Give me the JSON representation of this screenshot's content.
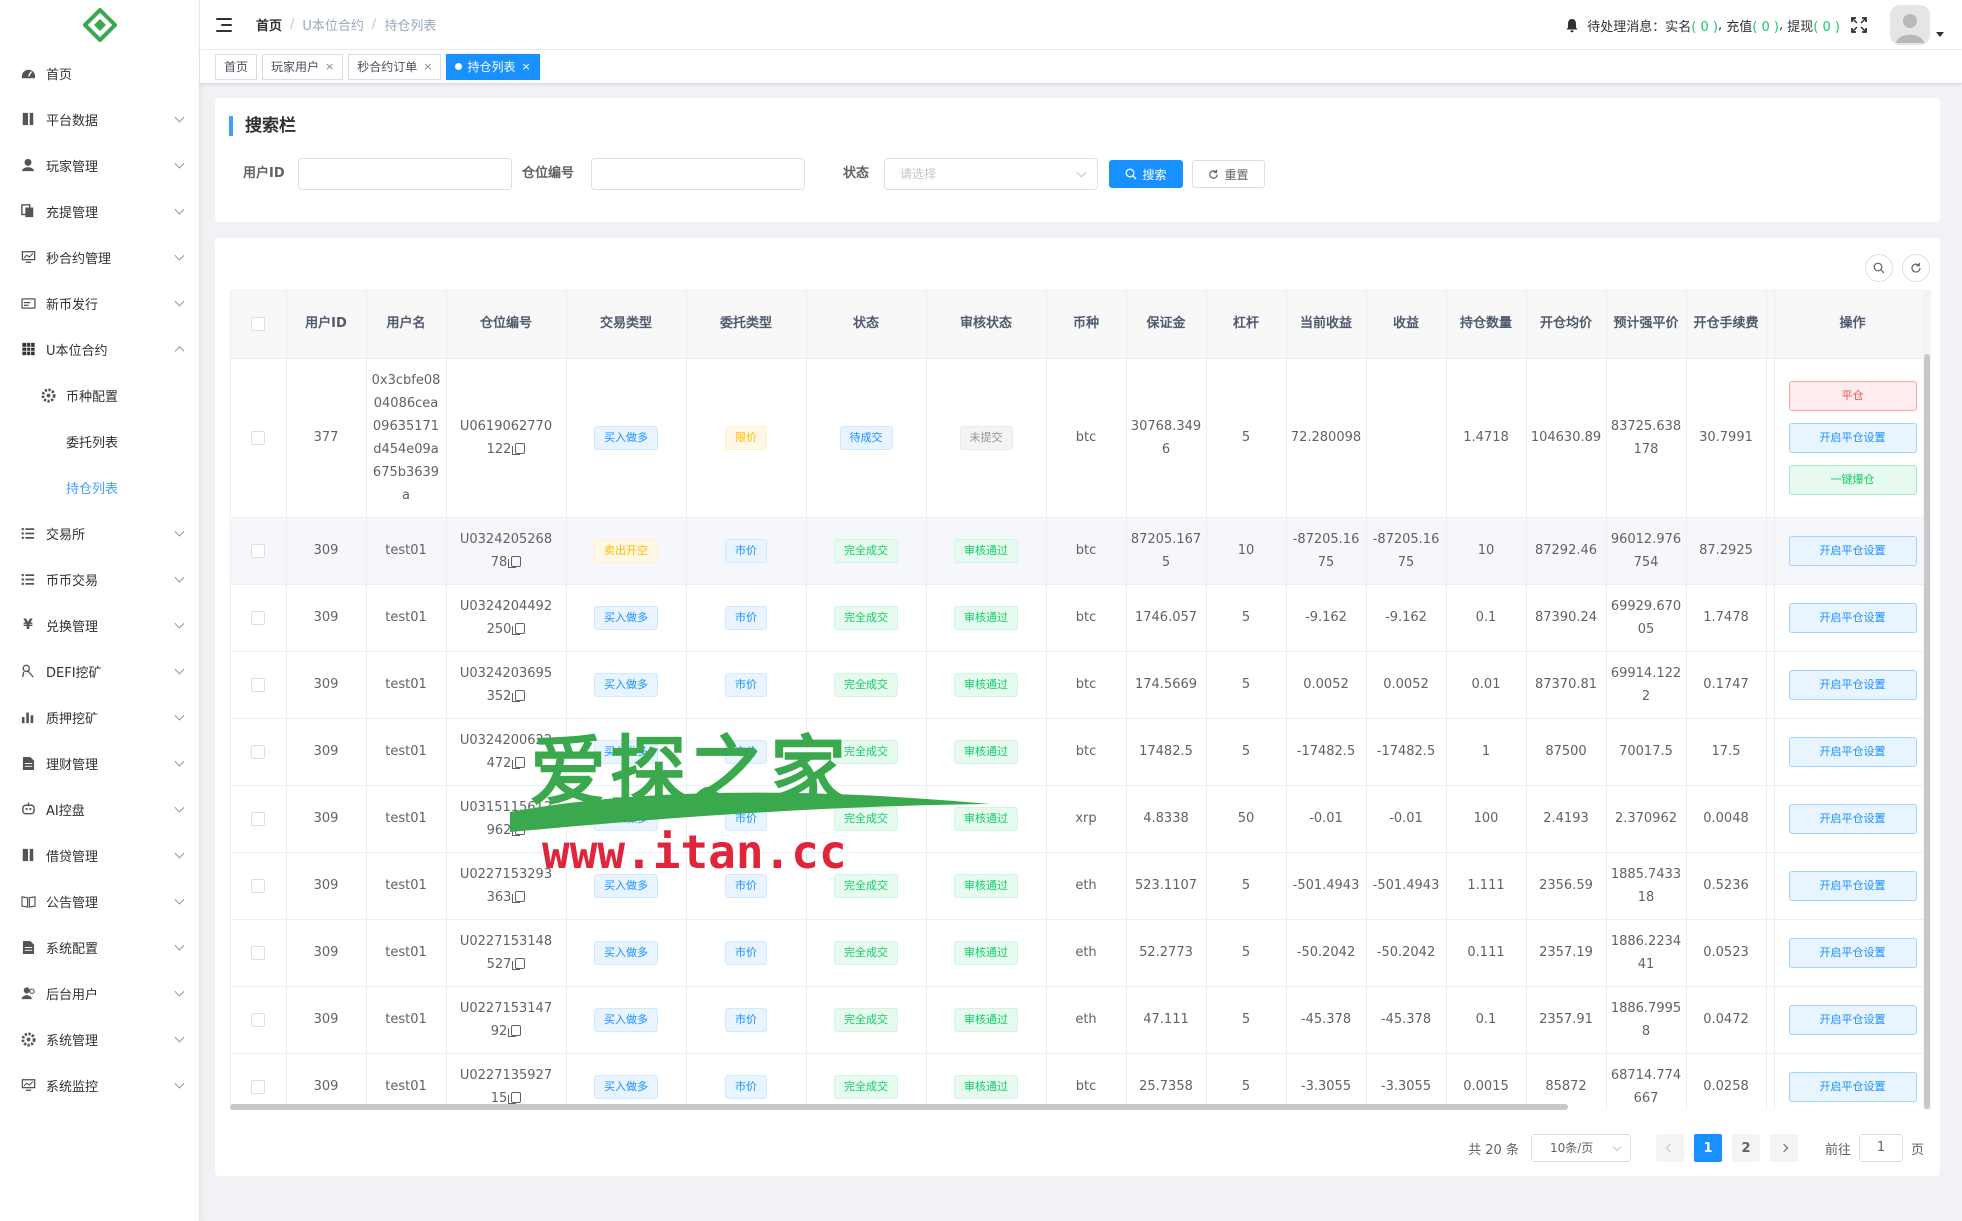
{
  "sidebar": {
    "items": [
      {
        "label": "首页",
        "icon": "dashboard-icon",
        "arrow": false
      },
      {
        "label": "平台数据",
        "icon": "book-icon",
        "arrow": true
      },
      {
        "label": "玩家管理",
        "icon": "user-icon",
        "arrow": true
      },
      {
        "label": "充提管理",
        "icon": "copy-icon",
        "arrow": true
      },
      {
        "label": "秒合约管理",
        "icon": "monitor-icon",
        "arrow": true
      },
      {
        "label": "新币发行",
        "icon": "card-icon",
        "arrow": true
      },
      {
        "label": "U本位合约",
        "icon": "table-icon",
        "arrow": true,
        "expanded": true
      },
      {
        "label": "币种配置",
        "icon": "gear-icon",
        "level": 1
      },
      {
        "label": "委托列表",
        "level": 2
      },
      {
        "label": "持仓列表",
        "level": 2,
        "active": true
      },
      {
        "label": "交易所",
        "icon": "list-icon",
        "arrow": true
      },
      {
        "label": "币币交易",
        "icon": "list-icon",
        "arrow": true
      },
      {
        "label": "兑换管理",
        "icon": "yen-icon",
        "arrow": true
      },
      {
        "label": "DEFI挖矿",
        "icon": "tool-icon",
        "arrow": true
      },
      {
        "label": "质押挖矿",
        "icon": "chart-icon",
        "arrow": true
      },
      {
        "label": "理财管理",
        "icon": "document-icon",
        "arrow": true
      },
      {
        "label": "AI控盘",
        "icon": "robot-icon",
        "arrow": true
      },
      {
        "label": "借贷管理",
        "icon": "book-icon",
        "arrow": true
      },
      {
        "label": "公告管理",
        "icon": "open-book-icon",
        "arrow": true
      },
      {
        "label": "系统配置",
        "icon": "document-icon",
        "arrow": true
      },
      {
        "label": "后台用户",
        "icon": "users-icon",
        "arrow": true
      },
      {
        "label": "系统管理",
        "icon": "gear-icon",
        "arrow": true
      },
      {
        "label": "系统监控",
        "icon": "monitor-icon",
        "arrow": true
      }
    ]
  },
  "navbar": {
    "breadcrumb": [
      "首页",
      "U本位合约",
      "持仓列表"
    ],
    "pending_label": "待处理消息：",
    "realname_label": "实名",
    "recharge_label": "充值",
    "withdraw_label": "提现",
    "realname_count": "0",
    "recharge_count": "0",
    "withdraw_count": "0"
  },
  "tags": [
    {
      "label": "首页",
      "closable": false,
      "active": false
    },
    {
      "label": "玩家用户",
      "closable": true,
      "active": false
    },
    {
      "label": "秒合约订单",
      "closable": true,
      "active": false
    },
    {
      "label": "持仓列表",
      "closable": true,
      "active": true
    }
  ],
  "search": {
    "title": "搜索栏",
    "user_id_label": "用户ID",
    "user_id_value": "",
    "position_no_label": "仓位编号",
    "position_no_value": "",
    "status_label": "状态",
    "status_placeholder": "请选择",
    "search_button": "搜索",
    "reset_button": "重置"
  },
  "table": {
    "columns": [
      "用户ID",
      "用户名",
      "仓位编号",
      "交易类型",
      "委托类型",
      "状态",
      "审核状态",
      "币种",
      "保证金",
      "杠杆",
      "当前收益",
      "收益",
      "持仓数量",
      "开仓均价",
      "预计强平价",
      "开仓手续费",
      "操作"
    ],
    "rows": [
      {
        "user_id": "377",
        "username": "0x3cbfe0804086cea09635171d454e09a675b3639a",
        "position_no": "U0619062770122",
        "trade_type": "买入做多",
        "order_type": "限价",
        "status": "待成交",
        "audit_status": "未提交",
        "coin": "btc",
        "margin": "30768.3496",
        "leverage": "5",
        "current_profit": "72.280098",
        "profit": "",
        "quantity": "1.4718",
        "open_price": "104630.89",
        "liq_price": "83725.638178",
        "open_fee": "30.7991",
        "actions": [
          "平仓",
          "开启平仓设置",
          "一键爆仓"
        ]
      },
      {
        "user_id": "309",
        "username": "test01",
        "position_no": "U032420526878",
        "trade_type": "卖出开空",
        "order_type": "市价",
        "status": "完全成交",
        "audit_status": "审核通过",
        "coin": "btc",
        "margin": "87205.1675",
        "leverage": "10",
        "current_profit": "-87205.1675",
        "profit": "-87205.1675",
        "quantity": "10",
        "open_price": "87292.46",
        "liq_price": "96012.976754",
        "open_fee": "87.2925",
        "actions": [
          "开启平仓设置"
        ]
      },
      {
        "user_id": "309",
        "username": "test01",
        "position_no": "U0324204492250",
        "trade_type": "买入做多",
        "order_type": "市价",
        "status": "完全成交",
        "audit_status": "审核通过",
        "coin": "btc",
        "margin": "1746.057",
        "leverage": "5",
        "current_profit": "-9.162",
        "profit": "-9.162",
        "quantity": "0.1",
        "open_price": "87390.24",
        "liq_price": "69929.67005",
        "open_fee": "1.7478",
        "actions": [
          "开启平仓设置"
        ]
      },
      {
        "user_id": "309",
        "username": "test01",
        "position_no": "U0324203695352",
        "trade_type": "买入做多",
        "order_type": "市价",
        "status": "完全成交",
        "audit_status": "审核通过",
        "coin": "btc",
        "margin": "174.5669",
        "leverage": "5",
        "current_profit": "0.0052",
        "profit": "0.0052",
        "quantity": "0.01",
        "open_price": "87370.81",
        "liq_price": "69914.1222",
        "open_fee": "0.1747",
        "actions": [
          "开启平仓设置"
        ]
      },
      {
        "user_id": "309",
        "username": "test01",
        "position_no": "U0324200622472",
        "trade_type": "买入做多",
        "order_type": "市价",
        "status": "完全成交",
        "audit_status": "审核通过",
        "coin": "btc",
        "margin": "17482.5",
        "leverage": "5",
        "current_profit": "-17482.5",
        "profit": "-17482.5",
        "quantity": "1",
        "open_price": "87500",
        "liq_price": "70017.5",
        "open_fee": "17.5",
        "actions": [
          "开启平仓设置"
        ]
      },
      {
        "user_id": "309",
        "username": "test01",
        "position_no": "U0315115612962",
        "trade_type": "买入做多",
        "order_type": "市价",
        "status": "完全成交",
        "audit_status": "审核通过",
        "coin": "xrp",
        "margin": "4.8338",
        "leverage": "50",
        "current_profit": "-0.01",
        "profit": "-0.01",
        "quantity": "100",
        "open_price": "2.4193",
        "liq_price": "2.370962",
        "open_fee": "0.0048",
        "actions": [
          "开启平仓设置"
        ]
      },
      {
        "user_id": "309",
        "username": "test01",
        "position_no": "U0227153293363",
        "trade_type": "买入做多",
        "order_type": "市价",
        "status": "完全成交",
        "audit_status": "审核通过",
        "coin": "eth",
        "margin": "523.1107",
        "leverage": "5",
        "current_profit": "-501.4943",
        "profit": "-501.4943",
        "quantity": "1.111",
        "open_price": "2356.59",
        "liq_price": "1885.743318",
        "open_fee": "0.5236",
        "actions": [
          "开启平仓设置"
        ]
      },
      {
        "user_id": "309",
        "username": "test01",
        "position_no": "U0227153148527",
        "trade_type": "买入做多",
        "order_type": "市价",
        "status": "完全成交",
        "audit_status": "审核通过",
        "coin": "eth",
        "margin": "52.2773",
        "leverage": "5",
        "current_profit": "-50.2042",
        "profit": "-50.2042",
        "quantity": "0.111",
        "open_price": "2357.19",
        "liq_price": "1886.223441",
        "open_fee": "0.0523",
        "actions": [
          "开启平仓设置"
        ]
      },
      {
        "user_id": "309",
        "username": "test01",
        "position_no": "U022715314792",
        "trade_type": "买入做多",
        "order_type": "市价",
        "status": "完全成交",
        "audit_status": "审核通过",
        "coin": "eth",
        "margin": "47.111",
        "leverage": "5",
        "current_profit": "-45.378",
        "profit": "-45.378",
        "quantity": "0.1",
        "open_price": "2357.91",
        "liq_price": "1886.79958",
        "open_fee": "0.0472",
        "actions": [
          "开启平仓设置"
        ]
      },
      {
        "user_id": "309",
        "username": "test01",
        "position_no": "U022713592715",
        "trade_type": "买入做多",
        "order_type": "市价",
        "status": "完全成交",
        "audit_status": "审核通过",
        "coin": "btc",
        "margin": "25.7358",
        "leverage": "5",
        "current_profit": "-3.3055",
        "profit": "-3.3055",
        "quantity": "0.0015",
        "open_price": "85872",
        "liq_price": "68714.774667",
        "open_fee": "0.0258",
        "actions": [
          "开启平仓设置"
        ]
      }
    ]
  },
  "pagination": {
    "total_text": "共 20 条",
    "page_size": "10条/页",
    "pages": [
      "1",
      "2"
    ],
    "current": "1",
    "goto_label": "前往",
    "goto_value": "1",
    "page_suffix": "页"
  },
  "watermark": {
    "line1": "爱探之家",
    "line2": "www.itan.cc"
  },
  "colors": {
    "primary": "#1890ff",
    "success": "#13ce66",
    "warning": "#ffba00",
    "danger": "#ff4949",
    "watermark_green": "#3aa84c",
    "watermark_red": "#e0243a"
  }
}
